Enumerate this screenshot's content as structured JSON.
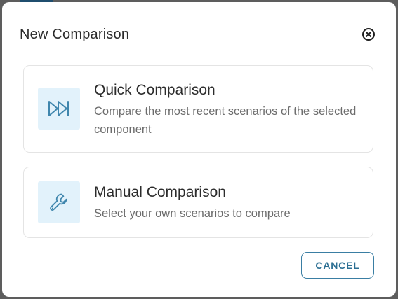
{
  "dialog": {
    "title": "New Comparison",
    "close_icon": "close-circle-icon"
  },
  "options": [
    {
      "title": "Quick Comparison",
      "description": "Compare the most recent scenarios of the selected component",
      "icon": "fast-forward-icon"
    },
    {
      "title": "Manual Comparison",
      "description": "Select your own scenarios to compare",
      "icon": "wrench-icon"
    }
  ],
  "footer": {
    "cancel_label": "CANCEL"
  },
  "colors": {
    "accent": "#2c6f93",
    "icon_bg": "#e2f2fb",
    "icon_stroke": "#3f86ad",
    "card_border": "#e4e4e4",
    "overlay": "#5d5d5d"
  }
}
